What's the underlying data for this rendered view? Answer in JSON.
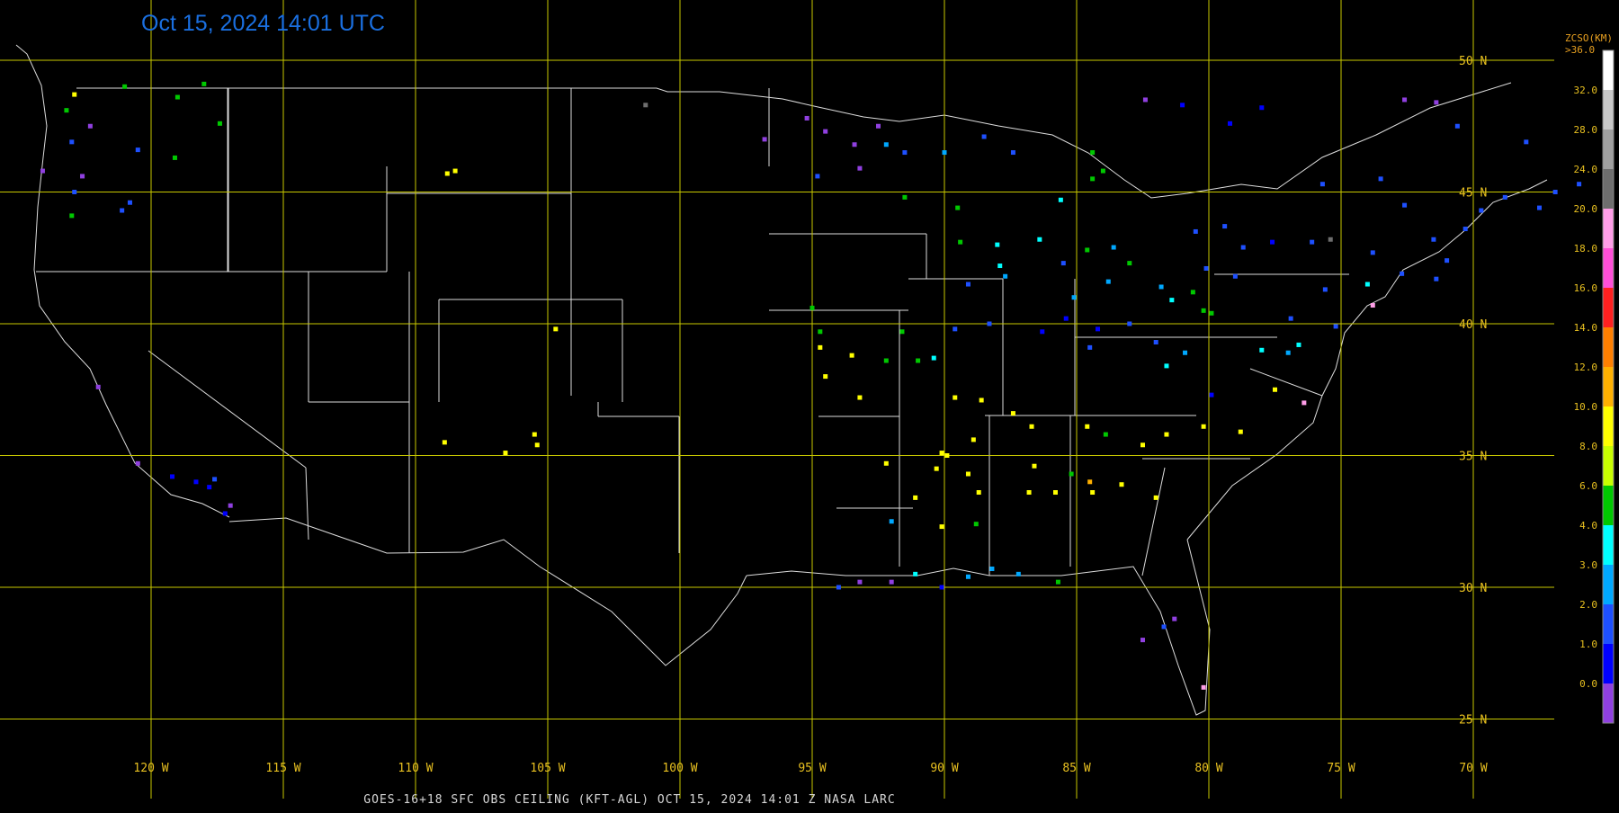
{
  "timestamp": "Oct 15, 2024 14:01 UTC",
  "footer": "GOES-16+18  SFC OBS CEILING (KFT-AGL)  OCT 15, 2024 14:01 Z  NASA LARC",
  "colorbar": {
    "title": "ZCSO(KM)",
    "top_label": ">36.0",
    "labels": [
      "32.0",
      "28.0",
      "24.0",
      "20.0",
      "18.0",
      "16.0",
      "14.0",
      "12.0",
      "10.0",
      "8.0",
      "6.0",
      "4.0",
      "3.0",
      "2.0",
      "1.0",
      "0.0"
    ],
    "colors": [
      "#ffffff",
      "#c8c8c8",
      "#a0a0a0",
      "#6e6e6e",
      "#ff9ee8",
      "#ff4fd8",
      "#ff2020",
      "#ff7f00",
      "#ffb000",
      "#ffff00",
      "#c8ff00",
      "#00c800",
      "#00ffff",
      "#00a8ff",
      "#1e50ff",
      "#0000ff",
      "#9040e0"
    ]
  },
  "lat_labels": [
    "50 N",
    "45 N",
    "40 N",
    "35 N",
    "30 N",
    "25 N"
  ],
  "lon_labels": [
    "120 W",
    "115 W",
    "110 W",
    "105 W",
    "100 W",
    "95 W",
    "90 W",
    "85 W",
    "80 W",
    "75 W",
    "70 W"
  ],
  "colors": {
    "grid": "#c8c800",
    "border": "#dddddd",
    "label": "#e8c020"
  },
  "stations": [
    {
      "lon": -122.3,
      "lat": 47.5,
      "c": "#9040e0"
    },
    {
      "lon": -122.6,
      "lat": 45.6,
      "c": "#9040e0"
    },
    {
      "lon": -123.0,
      "lat": 46.9,
      "c": "#1e50ff"
    },
    {
      "lon": -122.9,
      "lat": 48.7,
      "c": "#ffff00"
    },
    {
      "lon": -121.0,
      "lat": 49.0,
      "c": "#00c800"
    },
    {
      "lon": -119.0,
      "lat": 48.6,
      "c": "#00c800"
    },
    {
      "lon": -120.5,
      "lat": 46.6,
      "c": "#1e50ff"
    },
    {
      "lon": -119.1,
      "lat": 46.3,
      "c": "#00c800"
    },
    {
      "lon": -117.4,
      "lat": 47.6,
      "c": "#00c800"
    },
    {
      "lon": -118.0,
      "lat": 49.1,
      "c": "#00c800"
    },
    {
      "lon": -123.0,
      "lat": 44.1,
      "c": "#00c800"
    },
    {
      "lon": -122.9,
      "lat": 45.0,
      "c": "#1e50ff"
    },
    {
      "lon": -121.1,
      "lat": 44.3,
      "c": "#1e50ff"
    },
    {
      "lon": -120.8,
      "lat": 44.6,
      "c": "#1e50ff"
    },
    {
      "lon": -124.1,
      "lat": 45.8,
      "c": "#9040e0"
    },
    {
      "lon": -123.2,
      "lat": 48.1,
      "c": "#00c800"
    },
    {
      "lon": -122.0,
      "lat": 37.6,
      "c": "#9040e0"
    },
    {
      "lon": -119.2,
      "lat": 34.2,
      "c": "#0000ff"
    },
    {
      "lon": -118.3,
      "lat": 34.0,
      "c": "#0000ff"
    },
    {
      "lon": -117.8,
      "lat": 33.8,
      "c": "#0000ff"
    },
    {
      "lon": -117.2,
      "lat": 32.8,
      "c": "#0000ff"
    },
    {
      "lon": -117.6,
      "lat": 34.1,
      "c": "#1e50ff"
    },
    {
      "lon": -120.5,
      "lat": 34.7,
      "c": "#9040e0"
    },
    {
      "lon": -117.0,
      "lat": 33.1,
      "c": "#9040e0"
    },
    {
      "lon": -108.5,
      "lat": 45.8,
      "c": "#ffff00"
    },
    {
      "lon": -108.8,
      "lat": 45.7,
      "c": "#ffff00"
    },
    {
      "lon": -104.7,
      "lat": 39.8,
      "c": "#ffff00"
    },
    {
      "lon": -106.6,
      "lat": 35.1,
      "c": "#ffff00"
    },
    {
      "lon": -105.4,
      "lat": 35.4,
      "c": "#ffff00"
    },
    {
      "lon": -105.5,
      "lat": 35.8,
      "c": "#ffff00"
    },
    {
      "lon": -108.9,
      "lat": 35.5,
      "c": "#ffff00"
    },
    {
      "lon": -101.3,
      "lat": 48.3,
      "c": "#6e6e6e"
    },
    {
      "lon": -96.8,
      "lat": 47.0,
      "c": "#9040e0"
    },
    {
      "lon": -95.2,
      "lat": 47.8,
      "c": "#9040e0"
    },
    {
      "lon": -94.5,
      "lat": 47.3,
      "c": "#9040e0"
    },
    {
      "lon": -93.4,
      "lat": 46.8,
      "c": "#9040e0"
    },
    {
      "lon": -92.5,
      "lat": 47.5,
      "c": "#9040e0"
    },
    {
      "lon": -93.2,
      "lat": 45.9,
      "c": "#9040e0"
    },
    {
      "lon": -94.8,
      "lat": 45.6,
      "c": "#1e50ff"
    },
    {
      "lon": -91.5,
      "lat": 46.5,
      "c": "#1e50ff"
    },
    {
      "lon": -91.5,
      "lat": 44.8,
      "c": "#00c800"
    },
    {
      "lon": -89.5,
      "lat": 44.4,
      "c": "#00c800"
    },
    {
      "lon": -89.4,
      "lat": 43.1,
      "c": "#00c800"
    },
    {
      "lon": -88.0,
      "lat": 43.0,
      "c": "#00ffff"
    },
    {
      "lon": -87.9,
      "lat": 42.2,
      "c": "#00ffff"
    },
    {
      "lon": -87.7,
      "lat": 41.8,
      "c": "#00a8ff"
    },
    {
      "lon": -89.1,
      "lat": 41.5,
      "c": "#1e50ff"
    },
    {
      "lon": -89.6,
      "lat": 39.8,
      "c": "#1e50ff"
    },
    {
      "lon": -88.3,
      "lat": 40.0,
      "c": "#1e50ff"
    },
    {
      "lon": -86.3,
      "lat": 39.7,
      "c": "#0000ff"
    },
    {
      "lon": -85.4,
      "lat": 40.2,
      "c": "#0000ff"
    },
    {
      "lon": -85.1,
      "lat": 41.0,
      "c": "#00a8ff"
    },
    {
      "lon": -84.2,
      "lat": 39.8,
      "c": "#0000ff"
    },
    {
      "lon": -84.5,
      "lat": 39.1,
      "c": "#1e50ff"
    },
    {
      "lon": -83.0,
      "lat": 40.0,
      "c": "#1e50ff"
    },
    {
      "lon": -83.8,
      "lat": 41.6,
      "c": "#00a8ff"
    },
    {
      "lon": -81.8,
      "lat": 41.4,
      "c": "#00a8ff"
    },
    {
      "lon": -81.4,
      "lat": 40.9,
      "c": "#00ffff"
    },
    {
      "lon": -80.6,
      "lat": 41.2,
      "c": "#00c800"
    },
    {
      "lon": -80.2,
      "lat": 40.5,
      "c": "#00c800"
    },
    {
      "lon": -79.9,
      "lat": 40.4,
      "c": "#00c800"
    },
    {
      "lon": -82.0,
      "lat": 39.3,
      "c": "#1e50ff"
    },
    {
      "lon": -81.6,
      "lat": 38.4,
      "c": "#00ffff"
    },
    {
      "lon": -80.9,
      "lat": 38.9,
      "c": "#00a8ff"
    },
    {
      "lon": -79.9,
      "lat": 37.3,
      "c": "#0000ff"
    },
    {
      "lon": -78.0,
      "lat": 39.0,
      "c": "#00ffff"
    },
    {
      "lon": -77.5,
      "lat": 37.5,
      "c": "#ffff00"
    },
    {
      "lon": -76.4,
      "lat": 37.0,
      "c": "#ff9ee8"
    },
    {
      "lon": -78.8,
      "lat": 35.9,
      "c": "#ffff00"
    },
    {
      "lon": -80.2,
      "lat": 36.1,
      "c": "#ffff00"
    },
    {
      "lon": -81.6,
      "lat": 35.8,
      "c": "#ffff00"
    },
    {
      "lon": -82.5,
      "lat": 35.4,
      "c": "#ffff00"
    },
    {
      "lon": -83.9,
      "lat": 35.8,
      "c": "#00c800"
    },
    {
      "lon": -84.6,
      "lat": 36.1,
      "c": "#ffff00"
    },
    {
      "lon": -86.7,
      "lat": 36.1,
      "c": "#ffff00"
    },
    {
      "lon": -87.4,
      "lat": 36.6,
      "c": "#ffff00"
    },
    {
      "lon": -88.6,
      "lat": 37.1,
      "c": "#ffff00"
    },
    {
      "lon": -89.6,
      "lat": 37.2,
      "c": "#ffff00"
    },
    {
      "lon": -90.4,
      "lat": 38.7,
      "c": "#00ffff"
    },
    {
      "lon": -91.0,
      "lat": 38.6,
      "c": "#00c800"
    },
    {
      "lon": -92.2,
      "lat": 38.6,
      "c": "#00c800"
    },
    {
      "lon": -93.5,
      "lat": 38.8,
      "c": "#ffff00"
    },
    {
      "lon": -94.7,
      "lat": 39.1,
      "c": "#ffff00"
    },
    {
      "lon": -94.5,
      "lat": 38.0,
      "c": "#ffff00"
    },
    {
      "lon": -93.2,
      "lat": 37.2,
      "c": "#ffff00"
    },
    {
      "lon": -94.7,
      "lat": 39.7,
      "c": "#00c800"
    },
    {
      "lon": -95.0,
      "lat": 40.6,
      "c": "#00c800"
    },
    {
      "lon": -91.6,
      "lat": 39.7,
      "c": "#00c800"
    },
    {
      "lon": -90.1,
      "lat": 35.1,
      "c": "#ffff00"
    },
    {
      "lon": -89.9,
      "lat": 35.0,
      "c": "#ffff00"
    },
    {
      "lon": -88.9,
      "lat": 35.6,
      "c": "#ffff00"
    },
    {
      "lon": -90.3,
      "lat": 34.5,
      "c": "#ffff00"
    },
    {
      "lon": -89.1,
      "lat": 34.3,
      "c": "#ffff00"
    },
    {
      "lon": -88.7,
      "lat": 33.6,
      "c": "#ffff00"
    },
    {
      "lon": -86.8,
      "lat": 33.6,
      "c": "#ffff00"
    },
    {
      "lon": -85.8,
      "lat": 33.6,
      "c": "#ffff00"
    },
    {
      "lon": -84.4,
      "lat": 33.6,
      "c": "#ffff00"
    },
    {
      "lon": -83.3,
      "lat": 33.9,
      "c": "#ffff00"
    },
    {
      "lon": -82.0,
      "lat": 33.4,
      "c": "#ffff00"
    },
    {
      "lon": -84.5,
      "lat": 34.0,
      "c": "#ffb000"
    },
    {
      "lon": -85.2,
      "lat": 34.3,
      "c": "#00c800"
    },
    {
      "lon": -86.6,
      "lat": 34.6,
      "c": "#ffff00"
    },
    {
      "lon": -88.8,
      "lat": 32.4,
      "c": "#00c800"
    },
    {
      "lon": -90.1,
      "lat": 32.3,
      "c": "#ffff00"
    },
    {
      "lon": -91.1,
      "lat": 33.4,
      "c": "#ffff00"
    },
    {
      "lon": -92.2,
      "lat": 34.7,
      "c": "#ffff00"
    },
    {
      "lon": -92.0,
      "lat": 32.5,
      "c": "#00a8ff"
    },
    {
      "lon": -91.1,
      "lat": 30.5,
      "c": "#00ffff"
    },
    {
      "lon": -90.1,
      "lat": 30.0,
      "c": "#0000ff"
    },
    {
      "lon": -89.1,
      "lat": 30.4,
      "c": "#00a8ff"
    },
    {
      "lon": -88.2,
      "lat": 30.7,
      "c": "#00a8ff"
    },
    {
      "lon": -87.2,
      "lat": 30.5,
      "c": "#00a8ff"
    },
    {
      "lon": -93.2,
      "lat": 30.2,
      "c": "#9040e0"
    },
    {
      "lon": -92.0,
      "lat": 30.2,
      "c": "#9040e0"
    },
    {
      "lon": -94.0,
      "lat": 30.0,
      "c": "#1e50ff"
    },
    {
      "lon": -85.7,
      "lat": 30.2,
      "c": "#00c800"
    },
    {
      "lon": -81.7,
      "lat": 28.5,
      "c": "#1e50ff"
    },
    {
      "lon": -82.5,
      "lat": 28.0,
      "c": "#9040e0"
    },
    {
      "lon": -81.3,
      "lat": 28.8,
      "c": "#9040e0"
    },
    {
      "lon": -80.2,
      "lat": 26.2,
      "c": "#ff9ee8"
    },
    {
      "lon": -84.4,
      "lat": 45.5,
      "c": "#00c800"
    },
    {
      "lon": -84.0,
      "lat": 45.8,
      "c": "#00c800"
    },
    {
      "lon": -85.6,
      "lat": 44.7,
      "c": "#00ffff"
    },
    {
      "lon": -86.4,
      "lat": 43.2,
      "c": "#00ffff"
    },
    {
      "lon": -85.5,
      "lat": 42.3,
      "c": "#1e50ff"
    },
    {
      "lon": -84.6,
      "lat": 42.8,
      "c": "#00c800"
    },
    {
      "lon": -83.6,
      "lat": 42.9,
      "c": "#00a8ff"
    },
    {
      "lon": -83.0,
      "lat": 42.3,
      "c": "#00c800"
    },
    {
      "lon": -84.4,
      "lat": 46.5,
      "c": "#00c800"
    },
    {
      "lon": -87.4,
      "lat": 46.5,
      "c": "#1e50ff"
    },
    {
      "lon": -88.5,
      "lat": 47.1,
      "c": "#1e50ff"
    },
    {
      "lon": -90.0,
      "lat": 46.5,
      "c": "#00a8ff"
    },
    {
      "lon": -92.2,
      "lat": 46.8,
      "c": "#00a8ff"
    },
    {
      "lon": -78.7,
      "lat": 42.9,
      "c": "#1e50ff"
    },
    {
      "lon": -77.6,
      "lat": 43.1,
      "c": "#0000ff"
    },
    {
      "lon": -76.1,
      "lat": 43.1,
      "c": "#1e50ff"
    },
    {
      "lon": -75.4,
      "lat": 43.2,
      "c": "#6e6e6e"
    },
    {
      "lon": -73.8,
      "lat": 42.7,
      "c": "#1e50ff"
    },
    {
      "lon": -74.0,
      "lat": 41.5,
      "c": "#00ffff"
    },
    {
      "lon": -73.8,
      "lat": 40.7,
      "c": "#ff9ee8"
    },
    {
      "lon": -75.2,
      "lat": 39.9,
      "c": "#1e50ff"
    },
    {
      "lon": -76.6,
      "lat": 39.2,
      "c": "#00ffff"
    },
    {
      "lon": -77.0,
      "lat": 38.9,
      "c": "#00a8ff"
    },
    {
      "lon": -75.6,
      "lat": 41.3,
      "c": "#1e50ff"
    },
    {
      "lon": -76.9,
      "lat": 40.2,
      "c": "#1e50ff"
    },
    {
      "lon": -79.0,
      "lat": 41.8,
      "c": "#1e50ff"
    },
    {
      "lon": -80.1,
      "lat": 42.1,
      "c": "#1e50ff"
    },
    {
      "lon": -72.7,
      "lat": 41.9,
      "c": "#1e50ff"
    },
    {
      "lon": -71.4,
      "lat": 41.7,
      "c": "#1e50ff"
    },
    {
      "lon": -71.0,
      "lat": 42.4,
      "c": "#1e50ff"
    },
    {
      "lon": -72.6,
      "lat": 44.5,
      "c": "#1e50ff"
    },
    {
      "lon": -71.5,
      "lat": 43.2,
      "c": "#1e50ff"
    },
    {
      "lon": -70.3,
      "lat": 43.6,
      "c": "#1e50ff"
    },
    {
      "lon": -69.7,
      "lat": 44.3,
      "c": "#1e50ff"
    },
    {
      "lon": -68.8,
      "lat": 44.8,
      "c": "#1e50ff"
    },
    {
      "lon": -68.0,
      "lat": 46.9,
      "c": "#1e50ff"
    },
    {
      "lon": -70.6,
      "lat": 47.5,
      "c": "#1e50ff"
    },
    {
      "lon": -73.5,
      "lat": 45.5,
      "c": "#1e50ff"
    },
    {
      "lon": -75.7,
      "lat": 45.3,
      "c": "#1e50ff"
    },
    {
      "lon": -79.4,
      "lat": 43.7,
      "c": "#1e50ff"
    },
    {
      "lon": -80.5,
      "lat": 43.5,
      "c": "#1e50ff"
    },
    {
      "lon": -79.2,
      "lat": 47.6,
      "c": "#0000ff"
    },
    {
      "lon": -81.0,
      "lat": 48.3,
      "c": "#0000ff"
    },
    {
      "lon": -78.0,
      "lat": 48.2,
      "c": "#0000ff"
    },
    {
      "lon": -82.4,
      "lat": 48.5,
      "c": "#9040e0"
    },
    {
      "lon": -72.6,
      "lat": 48.5,
      "c": "#9040e0"
    },
    {
      "lon": -71.4,
      "lat": 48.4,
      "c": "#9040e0"
    },
    {
      "lon": -66.0,
      "lat": 45.3,
      "c": "#1e50ff"
    },
    {
      "lon": -66.9,
      "lat": 45.0,
      "c": "#1e50ff"
    },
    {
      "lon": -67.5,
      "lat": 44.4,
      "c": "#1e50ff"
    }
  ]
}
